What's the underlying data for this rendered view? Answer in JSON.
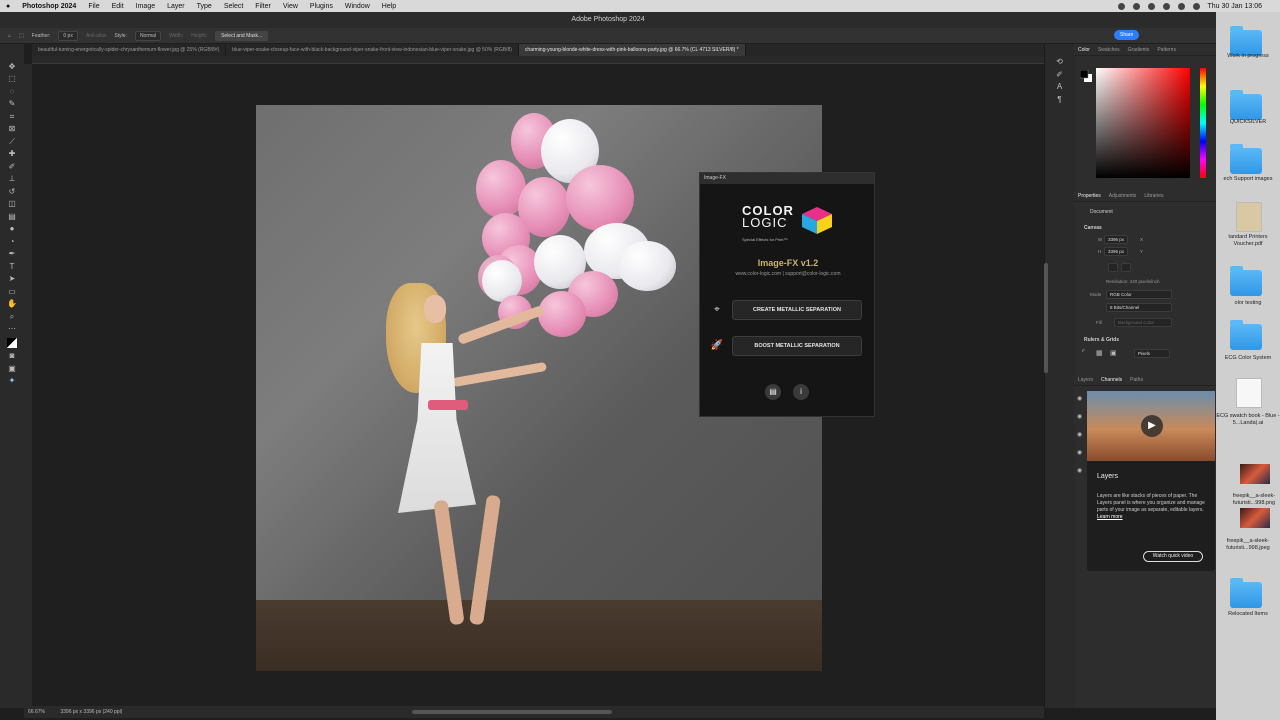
{
  "menubar": {
    "app": "Photoshop 2024",
    "items": [
      "File",
      "Edit",
      "Image",
      "Layer",
      "Type",
      "Select",
      "Filter",
      "View",
      "Plugins",
      "Window",
      "Help"
    ],
    "clock": "Thu 30 Jan 13:06"
  },
  "window": {
    "title": "Adobe Photoshop 2024"
  },
  "options": {
    "feather_label": "Feather:",
    "feather_value": "0 px",
    "antialias": "Anti-alias",
    "style_label": "Style:",
    "style_value": "Normal",
    "width_label": "Width:",
    "height_label": "Height:",
    "select_mask": "Select and Mask...",
    "share": "Share"
  },
  "tabs": [
    {
      "label": "beautiful-turning-energetically-spider-chrysanthemum-flower.jpg @ 25% (RGB/8#)"
    },
    {
      "label": "blue-viper-snake-closeup-face-with-black-background-viper-snake-front-view-indonesian-blue-viper-snake.jpg @ 50% (RGB/8)"
    },
    {
      "label": "charming-young-blonde-white-dress-with-pink-balloons-party.jpg @ 66.7% (CL 4713 SILVER/8) *"
    }
  ],
  "plugin": {
    "title": "Image-FX",
    "logo_line1": "COLOR",
    "logo_line2": "LOGIC",
    "logo_sub": "Special Effects for Print™",
    "version": "Image-FX v1.2",
    "url": "www.color-logic.com | support@color-logic.com",
    "btn_create": "CREATE METALLIC SEPARATION",
    "btn_boost": "BOOST METALLIC SEPARATION"
  },
  "color_panel": {
    "tabs": [
      "Color",
      "Swatches",
      "Gradients",
      "Patterns"
    ]
  },
  "properties": {
    "tabs": [
      "Properties",
      "Adjustments",
      "Libraries"
    ],
    "document": "Document",
    "canvas_title": "Canvas",
    "w_label": "W",
    "w_value": "3396 px",
    "h_label": "H",
    "h_value": "3396 px",
    "x_label": "X",
    "y_label": "Y",
    "resolution": "Resolution: 240 pixels/inch",
    "mode_label": "Mode",
    "mode_value": "RGB Color",
    "bits_value": "8 Bits/Channel",
    "fill_label": "Fill",
    "fill_value": "Background Color",
    "rulers_title": "Rulers & Grids",
    "units_value": "Pixels"
  },
  "layers_panel": {
    "tabs": [
      "Layers",
      "Channels",
      "Paths"
    ],
    "tip_title": "Layers",
    "tip_text": "Layers are like stacks of pieces of paper. The Layers panel is where you organize and manage parts of your image as separate, editable layers.",
    "tip_link": "Learn more",
    "tip_button": "Watch quick video"
  },
  "status": {
    "zoom": "66.67%",
    "doc": "3396 px x 3396 px (240 ppi)"
  },
  "desktop": [
    {
      "label": "Work in progress"
    },
    {
      "label": "QUICKSILVER"
    },
    {
      "label": "ech Support images"
    },
    {
      "label": "tandard Printers Voucher.pdf"
    },
    {
      "label": "olor testing"
    },
    {
      "label": "ECG Color System"
    },
    {
      "label": "ECG swatch book - Blue - 5...Landa).ai"
    },
    {
      "label": "freepik__a-sleek-futuristi...998.png"
    },
    {
      "label": "freepik__a-sleek-futuristi...998.jpeg"
    },
    {
      "label": "Relocated Items"
    }
  ],
  "colors": {
    "accent": "#2d7ff9",
    "plugin_title": "#cdb26e",
    "belt": "#e05c7d"
  }
}
